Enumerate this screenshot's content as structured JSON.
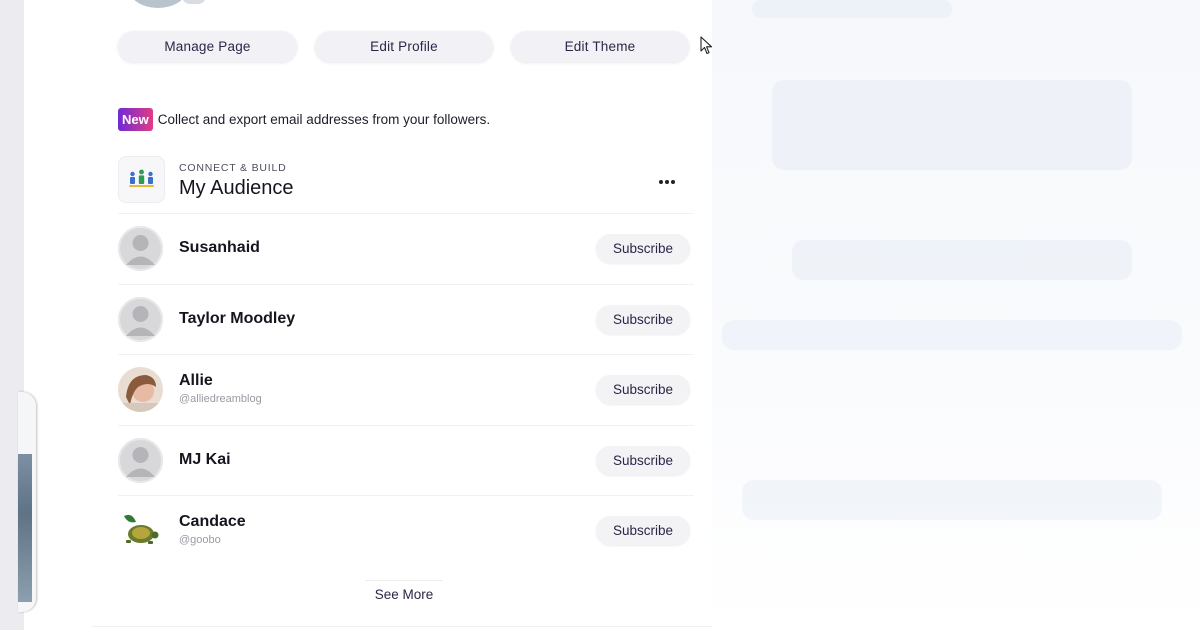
{
  "profile_actions": [
    {
      "label": "Manage Page"
    },
    {
      "label": "Edit Profile"
    },
    {
      "label": "Edit Theme"
    }
  ],
  "notice": {
    "badge": "New",
    "text": "Collect and export email addresses from your followers."
  },
  "section": {
    "eyebrow": "CONNECT & BUILD",
    "title": "My Audience",
    "icon": "audience-people-icon",
    "menu_icon": "more-horizontal-icon"
  },
  "followers": [
    {
      "name": "Susanhaid",
      "handle": "",
      "avatar": "default-avatar-icon",
      "button": "Subscribe"
    },
    {
      "name": "Taylor Moodley",
      "handle": "",
      "avatar": "default-avatar-icon",
      "button": "Subscribe"
    },
    {
      "name": "Allie",
      "handle": "@alliedreamblog",
      "avatar": "photo-avatar",
      "button": "Subscribe"
    },
    {
      "name": "MJ Kai",
      "handle": "",
      "avatar": "default-avatar-icon",
      "button": "Subscribe"
    },
    {
      "name": "Candace",
      "handle": "@goobo",
      "avatar": "turtle-avatar",
      "button": "Subscribe"
    }
  ],
  "see_more": "See More",
  "colors": {
    "new_badge_start": "#6f2bd6",
    "new_badge_end": "#e03c86",
    "pill_bg": "#f2f2f6",
    "pill_text": "#2a2747"
  }
}
